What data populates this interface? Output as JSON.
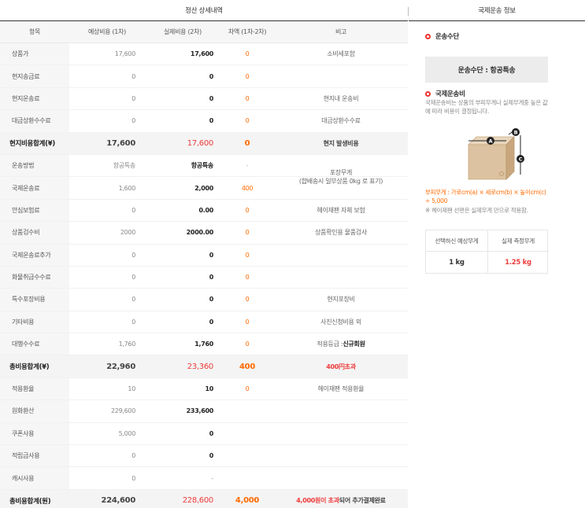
{
  "header": {
    "left_title": "정산 상세내역",
    "right_title": "국제운송 정보"
  },
  "table": {
    "columns": [
      "항목",
      "예상비용 (1차)",
      "실제비용 (2차)",
      "차액 (1차-2차)",
      "비고"
    ],
    "rows": [
      {
        "label": "상품가",
        "est": "17,600",
        "act": "17,600",
        "diff": "0",
        "note": "소비세포함"
      },
      {
        "label": "현지송금료",
        "est": "0",
        "act": "0",
        "diff": "0",
        "note": ""
      },
      {
        "label": "현지운송료",
        "est": "0",
        "act": "0",
        "diff": "0",
        "note": "현지내 운송비"
      },
      {
        "label": "대금상환수수료",
        "est": "0",
        "act": "0",
        "diff": "0",
        "note": "대금상환수수료"
      },
      {
        "label": "현지비용합계(¥)",
        "est": "17,600",
        "act": "17,600",
        "diff": "0",
        "note": "현지 발생비용",
        "total": true
      },
      {
        "label": "운송방법",
        "est": "항공특송",
        "act": "항공특송",
        "diff": "-",
        "note": ""
      },
      {
        "label": "국제운송료",
        "est": "1,600",
        "act": "2,000",
        "diff": "400",
        "note": ""
      },
      {
        "label": "안심보험료",
        "est": "0",
        "act": "0.00",
        "diff": "0",
        "note": "헤이재팬 자체 보험"
      },
      {
        "label": "상품검수비",
        "est": "2000",
        "act": "2000.00",
        "diff": "0",
        "note": "상품확인용 물품검사"
      },
      {
        "label": "국제운송료추가",
        "est": "0",
        "act": "0",
        "diff": "0",
        "note": ""
      },
      {
        "label": "화물취급수수료",
        "est": "0",
        "act": "0",
        "diff": "0",
        "note": ""
      },
      {
        "label": "특수포장비용",
        "est": "0",
        "act": "0",
        "diff": "0",
        "note": "현지포장비"
      },
      {
        "label": "기타비용",
        "est": "0",
        "act": "0",
        "diff": "0",
        "note": "사진신청비용 외"
      },
      {
        "label": "대행수수료",
        "est": "1,760",
        "act": "1,760",
        "diff": "0",
        "note_prefix": "적용등급 : ",
        "note_strong": "신규회원"
      },
      {
        "label": "총비용합계(¥)",
        "est": "22,960",
        "act": "23,360",
        "diff": "400",
        "note": "400円초과",
        "total": true,
        "note_red": true
      },
      {
        "label": "적용환율",
        "est": "10",
        "act": "10",
        "diff": "0",
        "note": "헤이재팬 적용환율"
      },
      {
        "label": "원화환산",
        "est": "229,600",
        "act": "233,600",
        "diff": "",
        "note": ""
      },
      {
        "label": "쿠폰사용",
        "est": "5,000",
        "act": "0",
        "diff": "",
        "note": ""
      },
      {
        "label": "적립금사용",
        "est": "0",
        "act": "0",
        "diff": "",
        "note": ""
      },
      {
        "label": "캐시사용",
        "est": "0",
        "act": "-",
        "diff": "",
        "note": ""
      },
      {
        "label": "총비용합계(원)",
        "est": "224,600",
        "act": "228,600",
        "diff": "4,000",
        "note_red_part": "4,000원이 초과",
        "note_rest": "되어 추가결제완료",
        "total": true
      }
    ],
    "package_note": "포장무게\n(합배송시 일부상품 0kg 로 표기)"
  },
  "panel": {
    "method_heading": "운송수단",
    "method_value": "운송수단 : 항공특송",
    "fee_heading": "국제운송비",
    "fee_desc": "국제운송비는 상품의 부피무게나 실제무게중 높은 값에 따라 비용이 결정됩니다.",
    "box_labels": [
      "A",
      "B",
      "C"
    ],
    "formula": "부피무게 : 가로cm(a) × 세로cm(b) × 높이cm(c) ÷ 5,000",
    "formula_note": "※ 헤이재팬 선편은 실제무게 만으로 적용함.",
    "weight_table": {
      "headers": [
        "선택하신 예상무게",
        "실제 측정무게"
      ],
      "values": [
        "1 kg",
        "1.25 kg"
      ]
    }
  },
  "colors": {
    "accent_red": "#ee3b3b",
    "accent_orange": "#ff6a00",
    "border_dark": "#333333"
  }
}
